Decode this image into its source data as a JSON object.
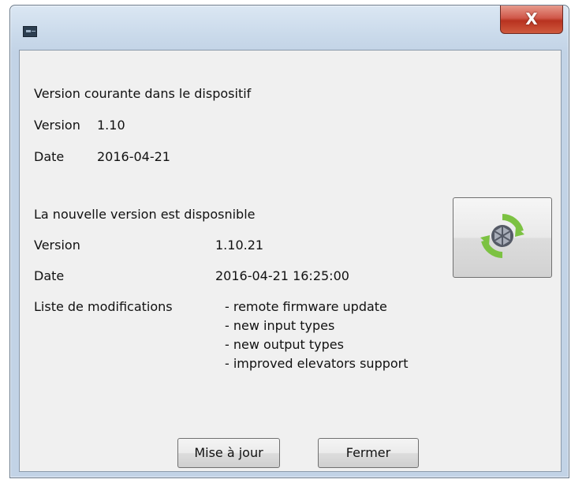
{
  "window": {
    "close_label": "X"
  },
  "current": {
    "heading": "Version courante dans le dispositif",
    "version_label": "Version",
    "version_value": "1.10",
    "date_label": "Date",
    "date_value": "2016-04-21"
  },
  "new": {
    "heading": "La nouvelle version  est disposnible",
    "version_label": "Version",
    "version_value": "1.10.21",
    "date_label": "Date",
    "date_value": "2016-04-21 16:25:00",
    "changes_label": "Liste de modifications",
    "changes": [
      "- remote firmware update",
      "- new input types",
      "- new output types",
      "- improved elevators support"
    ]
  },
  "buttons": {
    "update_label": "Mise à jour",
    "close_label": "Fermer"
  },
  "icons": {
    "app": "app-icon",
    "update": "firmware-update-icon"
  },
  "colors": {
    "update_icon_ring": "#7cc242",
    "update_icon_core": "#555a66",
    "close_button": "#c8402c"
  }
}
